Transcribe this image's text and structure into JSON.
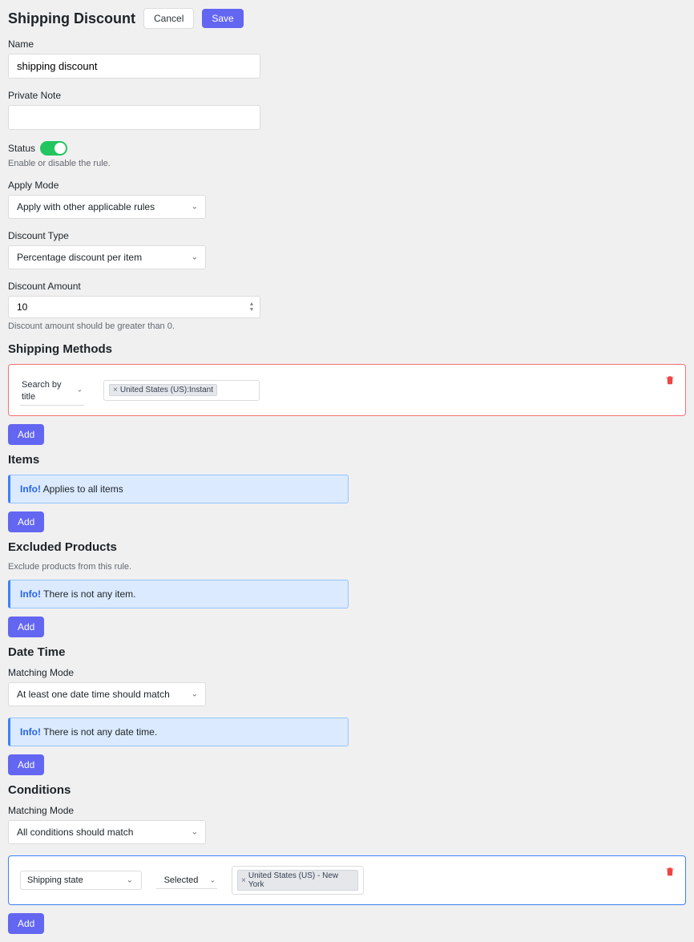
{
  "header": {
    "title": "Shipping Discount",
    "cancel_label": "Cancel",
    "save_label": "Save"
  },
  "name": {
    "label": "Name",
    "value": "shipping discount"
  },
  "private_note": {
    "label": "Private Note",
    "value": ""
  },
  "status": {
    "label": "Status",
    "hint": "Enable or disable the rule."
  },
  "apply_mode": {
    "label": "Apply Mode",
    "value": "Apply with other applicable rules"
  },
  "discount_type": {
    "label": "Discount Type",
    "value": "Percentage discount per item"
  },
  "discount_amount": {
    "label": "Discount Amount",
    "value": "10",
    "hint": "Discount amount should be greater than 0."
  },
  "shipping_methods": {
    "heading": "Shipping Methods",
    "search_label": "Search by title",
    "chip_text": "United States (US):Instant",
    "add_label": "Add"
  },
  "items": {
    "heading": "Items",
    "info_strong": "Info!",
    "info_text": " Applies to all items",
    "add_label": "Add"
  },
  "excluded": {
    "heading": "Excluded Products",
    "desc": "Exclude products from this rule.",
    "info_strong": "Info!",
    "info_text": " There is not any item.",
    "add_label": "Add"
  },
  "date_time": {
    "heading": "Date Time",
    "matching_label": "Matching Mode",
    "matching_value": "At least one date time should match",
    "info_strong": "Info!",
    "info_text": " There is not any date time.",
    "add_label": "Add"
  },
  "conditions": {
    "heading": "Conditions",
    "matching_label": "Matching Mode",
    "matching_value": "All conditions should match",
    "type_value": "Shipping state",
    "match_value": "Selected",
    "chip_text": "United States (US) - New York",
    "add_label": "Add"
  }
}
